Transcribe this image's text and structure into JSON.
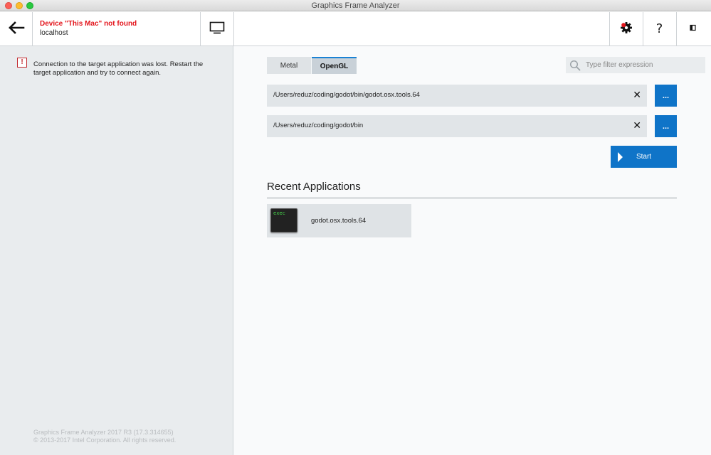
{
  "window": {
    "title": "Graphics Frame Analyzer"
  },
  "header": {
    "device_status": "Device \"This Mac\" not found",
    "device_host": "localhost",
    "help_label": "?"
  },
  "left_panel": {
    "alert_icon": "!",
    "alert_message": "Connection to the target application was lost. Restart the target application and try to connect again.",
    "footer_line1": "Graphics Frame Analyzer 2017 R3 (17.3.314655)",
    "footer_line2": "© 2013-2017 Intel Corporation. All rights reserved."
  },
  "main": {
    "tabs": [
      {
        "label": "Metal",
        "selected": false
      },
      {
        "label": "OpenGL",
        "selected": true
      }
    ],
    "filter": {
      "placeholder": "Type filter expression",
      "value": ""
    },
    "paths": [
      {
        "value": "/Users/reduz/coding/godot/bin/godot.osx.tools.64",
        "clear": "✕",
        "browse": "..."
      },
      {
        "value": "/Users/reduz/coding/godot/bin",
        "clear": "✕",
        "browse": "..."
      }
    ],
    "start_label": "Start",
    "recent": {
      "title": "Recent Applications",
      "items": [
        {
          "name": "godot.osx.tools.64",
          "icon_text": "exec"
        }
      ]
    }
  },
  "colors": {
    "accent": "#0f74c8",
    "error": "#e3141b",
    "sidebar_bg": "#e9ecee"
  }
}
